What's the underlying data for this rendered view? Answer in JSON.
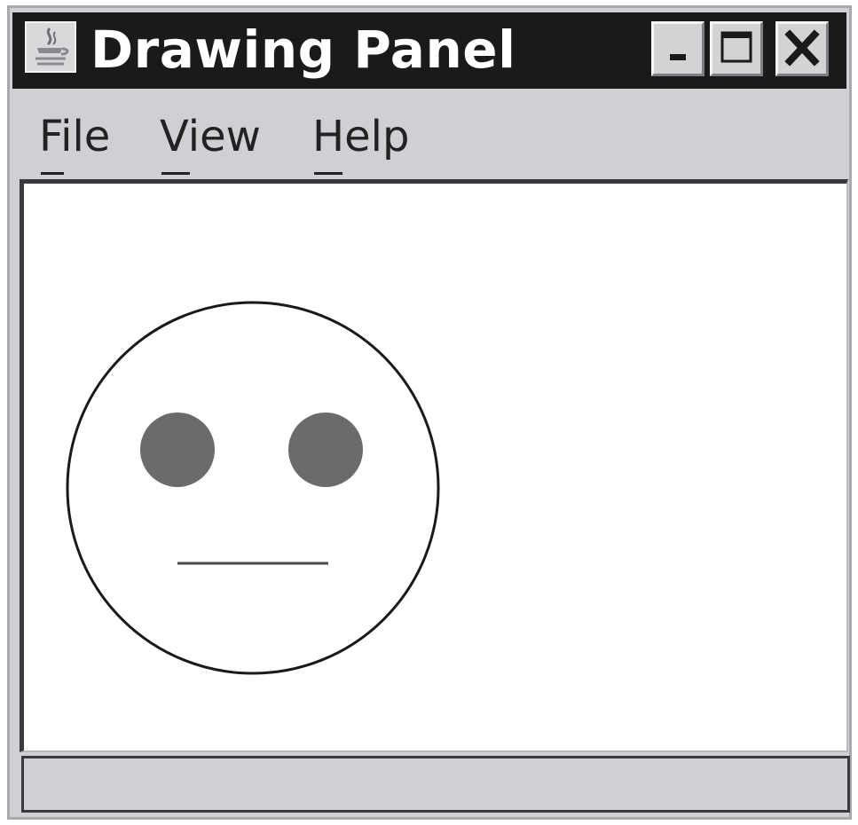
{
  "window": {
    "title": "Drawing Panel"
  },
  "menu": [
    {
      "label": "File",
      "mnemonic": "F"
    },
    {
      "label": "View",
      "mnemonic": "V"
    },
    {
      "label": "Help",
      "mnemonic": "H"
    }
  ],
  "icons": {
    "app": "java-coffee-cup-icon",
    "minimize": "minimize-icon",
    "maximize": "maximize-icon",
    "close": "close-icon"
  },
  "colors": {
    "titlebar_bg": "#1b191a",
    "title_text": "#ffffff",
    "chrome_bg": "#cfd0d4",
    "canvas_bg": "#ffffff",
    "face_outline": "#1a1a1a",
    "eye_fill": "#6b6b6b",
    "mouth_stroke": "#4a4a4a"
  },
  "status": {
    "text": ""
  }
}
